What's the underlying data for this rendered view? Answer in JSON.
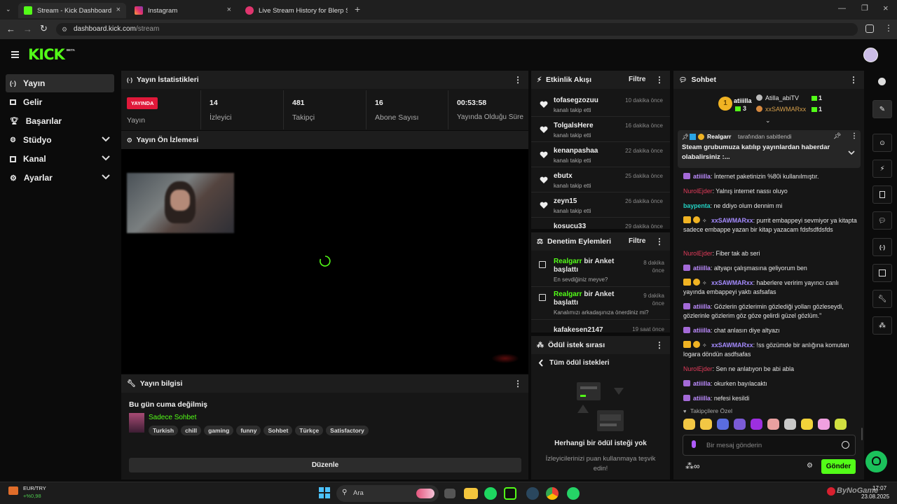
{
  "browser": {
    "tabs": [
      {
        "title": "Stream - Kick Dashboard",
        "active": true
      },
      {
        "title": "Instagram",
        "active": false
      },
      {
        "title": "Live Stream History for Blerp St",
        "active": false
      }
    ],
    "url_domain": "dashboard.kick.com",
    "url_path": "/stream"
  },
  "header": {
    "logo": "KICK",
    "logo_badge": "BETA"
  },
  "sidebar": {
    "items": [
      {
        "label": "Yayın",
        "icon": "broadcast-icon",
        "selected": true
      },
      {
        "label": "Gelir",
        "icon": "money-icon"
      },
      {
        "label": "Başarılar",
        "icon": "trophy-icon"
      },
      {
        "label": "Stüdyo",
        "icon": "studio-icon",
        "expandable": true
      },
      {
        "label": "Kanal",
        "icon": "channel-icon",
        "expandable": true
      },
      {
        "label": "Ayarlar",
        "icon": "gear-icon",
        "expandable": true
      }
    ]
  },
  "stats_panel": {
    "title": "Yayın İstatistikleri",
    "live_badge": "YAYINDA",
    "live_label": "Yayın",
    "stats": [
      {
        "value": "14",
        "label": "İzleyici"
      },
      {
        "value": "481",
        "label": "Takipçi"
      },
      {
        "value": "16",
        "label": "Abone Sayısı"
      },
      {
        "value": "00:53:58",
        "label": "Yayında Olduğu Süre"
      }
    ]
  },
  "preview_panel": {
    "title": "Yayın Ön İzlemesi"
  },
  "info_panel": {
    "title": "Yayın bilgisi",
    "stream_title": "Bu gün cuma değilmiş",
    "category": "Sadece Sohbet",
    "tags": [
      "Turkish",
      "chill",
      "gaming",
      "funny",
      "Sohbet",
      "Türkçe",
      "Satisfactory"
    ],
    "edit_button": "Düzenle"
  },
  "activity_panel": {
    "title": "Etkinlik Akışı",
    "filter": "Filtre",
    "events": [
      {
        "name": "tofasegzozuu",
        "sub": "kanalı takip etti",
        "time": "10 dakika önce"
      },
      {
        "name": "TolgalsHere",
        "sub": "kanalı takip etti",
        "time": "16 dakika önce"
      },
      {
        "name": "kenanpashaa",
        "sub": "kanalı takip etti",
        "time": "22 dakika önce"
      },
      {
        "name": "ebutx",
        "sub": "kanalı takip etti",
        "time": "25 dakika önce"
      },
      {
        "name": "zeyn15",
        "sub": "kanalı takip etti",
        "time": "26 dakika önce"
      },
      {
        "name": "kosucu33",
        "sub": "",
        "time": "29 dakika önce"
      }
    ]
  },
  "moderation_panel": {
    "title": "Denetim Eylemleri",
    "filter": "Filtre",
    "actions": [
      {
        "user": "Realgarr",
        "action": " bir Anket başlattı",
        "detail": "En sevdiğiniz meyve?",
        "time": "8 dakika önce"
      },
      {
        "user": "Realgarr",
        "action": " bir Anket başlattı",
        "detail": "Kanalımızı arkadaşınıza önerdiniz mi?",
        "time": "9 dakika önce"
      },
      {
        "user": "kafakesen2147",
        "action": "",
        "detail": "",
        "time": "19 saat önce"
      }
    ]
  },
  "rewards_panel": {
    "title": "Ödül istek sırası",
    "back_label": "Tüm ödül istekleri",
    "empty_title": "Herhangi bir ödül isteği yok",
    "empty_text": "İzleyicilerinizi puan kullanmaya teşvik edin!"
  },
  "chat_panel": {
    "title": "Sohbet",
    "leaderboard": [
      {
        "name": "atiiilla",
        "rank": "1",
        "count": "3"
      },
      {
        "name": "Atilla_abiTV",
        "count": "1"
      },
      {
        "name": "xxSAWMARxx",
        "count": "1"
      }
    ],
    "pinned": {
      "by": "Realgarr",
      "by_suffix": "tarafından sabitlendi",
      "text": "Steam grubumuza katılıp yayınlardan haberdar olabalirsiniz :..."
    },
    "messages": [
      {
        "user": "atiiilla",
        "text": "İnternet paketinizin %80i kullanılmıştır.",
        "color": "purple",
        "badges": "sub"
      },
      {
        "user": "NurolEjder",
        "text": "Yalnış internet nassı oluyo",
        "color": "red",
        "badges": ""
      },
      {
        "user": "baypenta",
        "text": "ne ddiyo olum dennim mi",
        "color": "teal",
        "badges": ""
      },
      {
        "user": "xxSAWMARxx",
        "text": "purrit embappeyi sevmiyor ya kitapta sadece embappe yazan bir kitap yazacam fdsfsdfdsfds",
        "color": "violet",
        "badges": "crown"
      },
      {
        "user": "NurolEjder",
        "text": "Fiber tak ab seri",
        "color": "red",
        "badges": ""
      },
      {
        "user": "atiiilla",
        "text": "altyapı çalışmasına geliyorum ben",
        "color": "purple",
        "badges": "sub"
      },
      {
        "user": "xxSAWMARxx",
        "text": "haberlere veririm yayıncı canlı yayında embappeyi yaktı asfsafas",
        "color": "violet",
        "badges": "crown"
      },
      {
        "user": "atiiilla",
        "text": "Gözlerin gözlerimin gözlediği yolları gözleseydi, gözlerinle gözlerim göz göze gelirdi güzel gözlüm.\"",
        "color": "purple",
        "badges": "sub"
      },
      {
        "user": "atiiilla",
        "text": "chat anlasın diye altyazı",
        "color": "purple",
        "badges": "sub"
      },
      {
        "user": "xxSAWMARxx",
        "text": "!ss gözümde bir anlığına komutan logara döndün asdfsafas",
        "color": "violet",
        "badges": "crown"
      },
      {
        "user": "NurolEjder",
        "text": "Sen ne anlatıyon be abi abla",
        "color": "red",
        "badges": ""
      },
      {
        "user": "atiiilla",
        "text": "okurken bayılacaktı",
        "color": "purple",
        "badges": "sub"
      },
      {
        "user": "atiiilla",
        "text": "nefesi kesildi",
        "color": "purple",
        "badges": "sub"
      }
    ],
    "emote_label": "Takipçilere Özel",
    "input_placeholder": "Bir mesaj gönderin",
    "send_button": "Gönder"
  },
  "taskbar": {
    "currency_pair": "EUR/TRY",
    "currency_change": "+%0,98",
    "search_placeholder": "Ara",
    "time": "17:07",
    "date": "23.08.2025",
    "watermark": "ByNoGame"
  },
  "colors": {
    "kick_green": "#53fc18",
    "live_red": "#e0193a"
  }
}
